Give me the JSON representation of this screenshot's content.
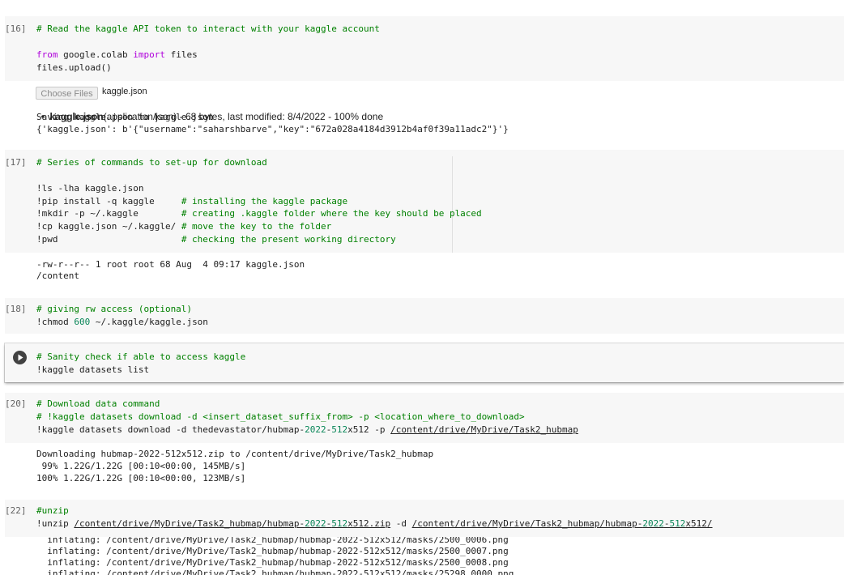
{
  "cell16": {
    "prompt": "[16]",
    "lines": [
      "# Read the kaggle API token to interact with your kaggle account",
      "",
      "from google.colab import files",
      "files.upload()"
    ],
    "kw_from": "from",
    "mod_name": " google.colab ",
    "kw_import": "import",
    "import_tail": " files",
    "line4": "files.upload()",
    "choose_files": "Choose Files",
    "chosen_file": "kaggle.json",
    "file_name_bold": "kaggle.json",
    "file_meta": "(application/json) - 68 bytes, last modified: 8/4/2022 - 100% done",
    "saving": "Saving kaggle.json to kaggle.json",
    "dict_output": "{'kaggle.json': b'{\"username\":\"saharshbarve\",\"key\":\"672a028a4184d3912b4af0f39a11adc2\"}'}"
  },
  "cell17": {
    "prompt": "[17]",
    "comment": "# Series of commands to set-up for download",
    "cmd1": "!ls -lha kaggle.json",
    "cmd2": "!pip install -q kaggle     ",
    "cmd2_comment": "# installing the kaggle package",
    "cmd3": "!mkdir -p ~/.kaggle        ",
    "cmd3_comment": "# creating .kaggle folder where the key should be placed",
    "cmd4": "!cp kaggle.json ~/.kaggle/ ",
    "cmd4_comment": "# move the key to the folder",
    "cmd5": "!pwd                       ",
    "cmd5_comment": "# checking the present working directory",
    "out1": "-rw-r--r-- 1 root root 68 Aug  4 09:17 kaggle.json",
    "out2": "/content"
  },
  "cell18": {
    "prompt": "[18]",
    "comment": "# giving rw access (optional)",
    "cmd_pre": "!chmod ",
    "cmd_num": "600",
    "cmd_post": " ~/.kaggle/kaggle.json"
  },
  "cell19": {
    "comment": "# Sanity check if able to access kaggle",
    "cmd": "!kaggle datasets list"
  },
  "cell20": {
    "prompt": "[20]",
    "comment1": "# Download data command",
    "comment2": "# !kaggle datasets download -d <insert_dataset_suffix_from> -p <location_where_to_download>",
    "cmd_pre": "!kaggle datasets download -d thedevastator/hubmap-",
    "cmd_num1": "2022",
    "cmd_mid1": "-",
    "cmd_num2": "512",
    "cmd_mid2": "x512 -p ",
    "cmd_path": "/content/drive/MyDrive/Task2_hubmap",
    "out1": "Downloading hubmap-2022-512x512.zip to /content/drive/MyDrive/Task2_hubmap",
    "out2": " 99% 1.22G/1.22G [00:10<00:00, 145MB/s]",
    "out3": "100% 1.22G/1.22G [00:10<00:00, 123MB/s]"
  },
  "cell22": {
    "prompt": "[22]",
    "comment": "#unzip",
    "cmd_pre": "!unzip ",
    "path1_a": "/content/drive/MyDrive/Task2_hubmap/hubmap-",
    "path1_n1": "2022",
    "path1_b": "-",
    "path1_n2": "512",
    "path1_c": "x512.zip",
    "cmd_mid": " -d ",
    "path2_a": "/content/drive/MyDrive/Task2_hubmap/hubmap-",
    "path2_n1": "2022",
    "path2_b": "-",
    "path2_n2": "512",
    "path2_c": "x512/",
    "out0": "  inflating: /content/drive/MyDrive/Task2_hubmap/hubmap-2022-512x512/masks/2500_0006.png",
    "out1": "  inflating: /content/drive/MyDrive/Task2_hubmap/hubmap-2022-512x512/masks/2500_0007.png",
    "out2": "  inflating: /content/drive/MyDrive/Task2_hubmap/hubmap-2022-512x512/masks/2500_0008.png",
    "out3": "  inflating: /content/drive/MyDrive/Task2_hubmap/hubmap-2022-512x512/masks/25298_0000.png"
  }
}
